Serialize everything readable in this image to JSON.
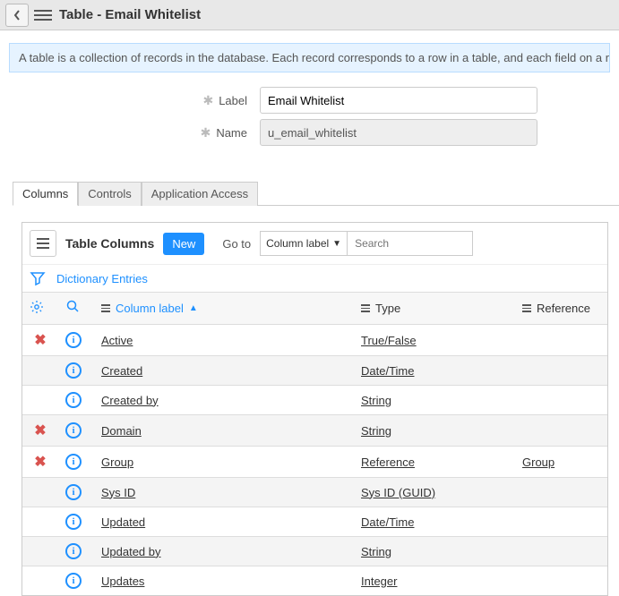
{
  "header": {
    "title": "Table - Email Whitelist"
  },
  "banner": {
    "text": "A table is a collection of records in the database. Each record corresponds to a row in a table, and each field on a reco"
  },
  "form": {
    "label_field": {
      "label": "Label",
      "value": "Email Whitelist"
    },
    "name_field": {
      "label": "Name",
      "value": "u_email_whitelist"
    }
  },
  "tabs": [
    {
      "label": "Columns",
      "active": true
    },
    {
      "label": "Controls",
      "active": false
    },
    {
      "label": "Application Access",
      "active": false
    }
  ],
  "list": {
    "title": "Table Columns",
    "new_btn": "New",
    "goto_label": "Go to",
    "goto_select": "Column label",
    "search_placeholder": "Search",
    "dictionary_link": "Dictionary Entries",
    "columns": {
      "label": "Column label",
      "type": "Type",
      "reference": "Reference"
    },
    "rows": [
      {
        "deletable": true,
        "label": "Active",
        "type": "True/False",
        "reference": ""
      },
      {
        "deletable": false,
        "label": "Created",
        "type": "Date/Time",
        "reference": ""
      },
      {
        "deletable": false,
        "label": "Created by",
        "type": "String",
        "reference": ""
      },
      {
        "deletable": true,
        "label": "Domain",
        "type": "String",
        "reference": ""
      },
      {
        "deletable": true,
        "label": "Group",
        "type": "Reference",
        "reference": "Group"
      },
      {
        "deletable": false,
        "label": "Sys ID",
        "type": "Sys ID (GUID)",
        "reference": ""
      },
      {
        "deletable": false,
        "label": "Updated",
        "type": "Date/Time",
        "reference": ""
      },
      {
        "deletable": false,
        "label": "Updated by",
        "type": "String",
        "reference": ""
      },
      {
        "deletable": false,
        "label": "Updates",
        "type": "Integer",
        "reference": ""
      }
    ]
  }
}
